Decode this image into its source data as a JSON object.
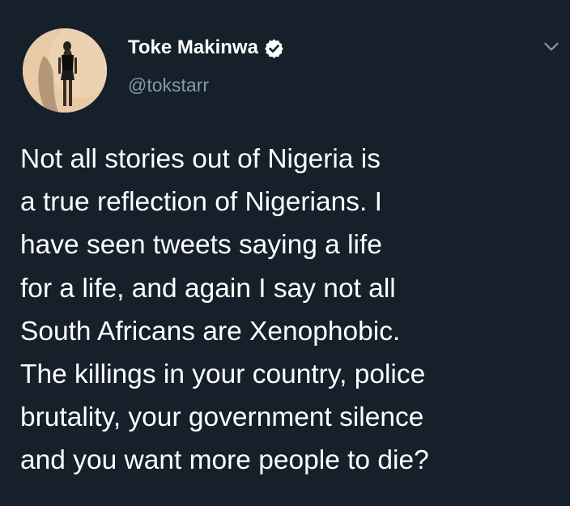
{
  "tweet": {
    "author": {
      "name": "Toke Makinwa",
      "handle": "@tokstarr",
      "verified": true,
      "avatar_icon": "profile-photo"
    },
    "menu_icon": "chevron-down-icon",
    "body_lines": [
      "Not all stories out of Nigeria is",
      "a true reflection of Nigerians. I",
      "have seen tweets saying a life",
      "for a life, and again I say not all",
      "South Africans are Xenophobic.",
      "The killings in your country, police",
      "brutality, your government silence",
      "and you want more people to die?"
    ]
  },
  "colors": {
    "background": "#15202b",
    "primary_text": "#ffffff",
    "secondary_text": "#8899a6",
    "verified_badge": "#ffffff"
  }
}
